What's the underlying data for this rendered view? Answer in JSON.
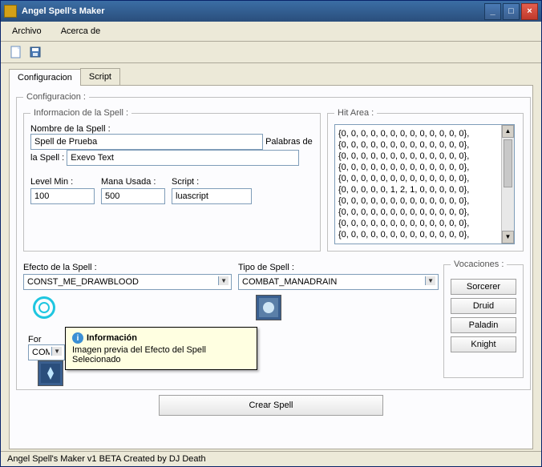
{
  "window": {
    "title": "Angel Spell's Maker"
  },
  "menu": {
    "archivo": "Archivo",
    "acerca": "Acerca de"
  },
  "tabs": {
    "config": "Configuracion",
    "script": "Script"
  },
  "groups": {
    "config": "Configuracion :",
    "info": "Informacion de la Spell :",
    "hit": "Hit Area :",
    "voc": "Vocaciones :"
  },
  "labels": {
    "nombre": "Nombre de la Spell :",
    "palabras": "Palabras de la Spell :",
    "levelmin": "Level Min :",
    "mana": "Mana Usada :",
    "script": "Script :",
    "efecto": "Efecto de la Spell :",
    "tipo": "Tipo de Spell :",
    "for": "For"
  },
  "values": {
    "nombre": "Spell de Prueba",
    "palabras": "Exevo Text",
    "levelmin": "100",
    "mana": "500",
    "script": "luascript",
    "efecto": "CONST_ME_DRAWBLOOD",
    "tipo": "COMBAT_MANADRAIN",
    "for_select": "COM"
  },
  "hit_lines": [
    "{0, 0, 0, 0, 0, 0, 0, 0, 0, 0, 0, 0, 0},",
    "{0, 0, 0, 0, 0, 0, 0, 0, 0, 0, 0, 0, 0},",
    "{0, 0, 0, 0, 0, 0, 0, 0, 0, 0, 0, 0, 0},",
    "{0, 0, 0, 0, 0, 0, 0, 0, 0, 0, 0, 0, 0},",
    "{0, 0, 0, 0, 0, 0, 0, 0, 0, 0, 0, 0, 0},",
    "{0, 0, 0, 0, 0, 1, 2, 1, 0, 0, 0, 0, 0},",
    "{0, 0, 0, 0, 0, 0, 0, 0, 0, 0, 0, 0, 0},",
    "{0, 0, 0, 0, 0, 0, 0, 0, 0, 0, 0, 0, 0},",
    "{0, 0, 0, 0, 0, 0, 0, 0, 0, 0, 0, 0, 0},",
    "{0, 0, 0, 0, 0, 0, 0, 0, 0, 0, 0, 0, 0},"
  ],
  "voc": {
    "sorcerer": "Sorcerer",
    "druid": "Druid",
    "paladin": "Paladin",
    "knight": "Knight"
  },
  "tooltip": {
    "title": "Información",
    "body": "Imagen previa del Efecto del Spell Selecionado"
  },
  "create_btn": "Crear Spell",
  "status": "Angel Spell's Maker v1 BETA Created by DJ Death"
}
